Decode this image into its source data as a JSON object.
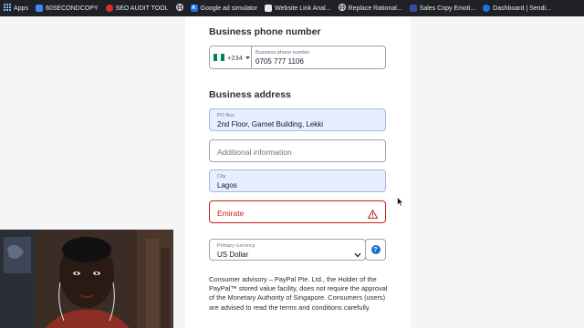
{
  "bookmarks": [
    {
      "label": "Apps",
      "icon": "apps-grid-icon",
      "color": "#8ab4f8"
    },
    {
      "label": "60SECONDCOPY",
      "icon": "bookmark-page-icon",
      "color": "#4285f4"
    },
    {
      "label": "SEO AUDIT TOOL",
      "icon": "seo-tool-icon",
      "color": "#d93025"
    },
    {
      "label": "",
      "icon": "globe-icon",
      "color": "#e8eaed"
    },
    {
      "label": "Google ad simulator",
      "icon": "k-logo-icon",
      "color": "#1a73e8"
    },
    {
      "label": "Website Link Anal...",
      "icon": "link-analyzer-icon",
      "color": "#e8eaed"
    },
    {
      "label": "Replace Rational...",
      "icon": "globe-icon",
      "color": "#e8eaed"
    },
    {
      "label": "Sales Copy Emoti...",
      "icon": "sales-copy-icon",
      "color": "#3949ab"
    },
    {
      "label": "Dashboard | Sendi...",
      "icon": "dashboard-icon",
      "color": "#1a73e8"
    }
  ],
  "phone": {
    "section_title": "Business phone number",
    "country_code": "+234",
    "label": "Business phone number",
    "value": "0705 777 1106"
  },
  "address": {
    "section_title": "Business address",
    "po_box_label": "PO Box",
    "po_box_value": "2nd Floor, Garnet Building, Lekki",
    "additional_placeholder": "Additional information",
    "city_label": "City",
    "city_value": "Lagos",
    "emirate_placeholder": "Emirate"
  },
  "currency": {
    "label": "Primary currency",
    "value": "US Dollar",
    "help": "?"
  },
  "advisory": "Consumer advisory – PayPal Pte. Ltd., the Holder of the PayPal™ stored value facility, does not require the approval of the Monetary Authority of Singapore. Consumers (users) are advised to read the terms and conditions carefully.",
  "colors": {
    "accent": "#1f6fd1",
    "error": "#c5221f",
    "filled_bg": "#e6efff"
  }
}
